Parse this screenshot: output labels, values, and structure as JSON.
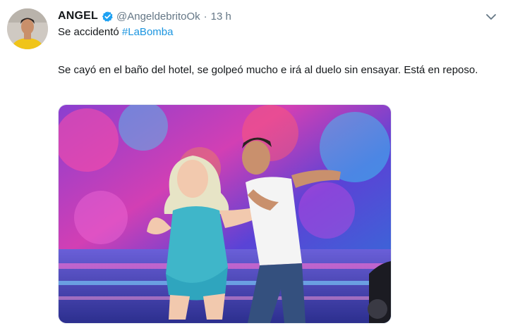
{
  "tweet": {
    "author_name": "ANGEL",
    "handle": "@AngeldebritoOk",
    "separator": "·",
    "time": "13 h",
    "headline_text": "Se accidentó",
    "hashtag": "#LaBomba",
    "body": "Se cayó en el baño del hotel, se golpeó mucho e irá al duelo sin ensayar. Está en reposo."
  },
  "icons": {
    "verified": "verified-badge-icon",
    "menu": "chevron-down-icon"
  },
  "colors": {
    "link": "#1b95e0",
    "secondary_text": "#657786",
    "verified": "#1da1f2"
  }
}
